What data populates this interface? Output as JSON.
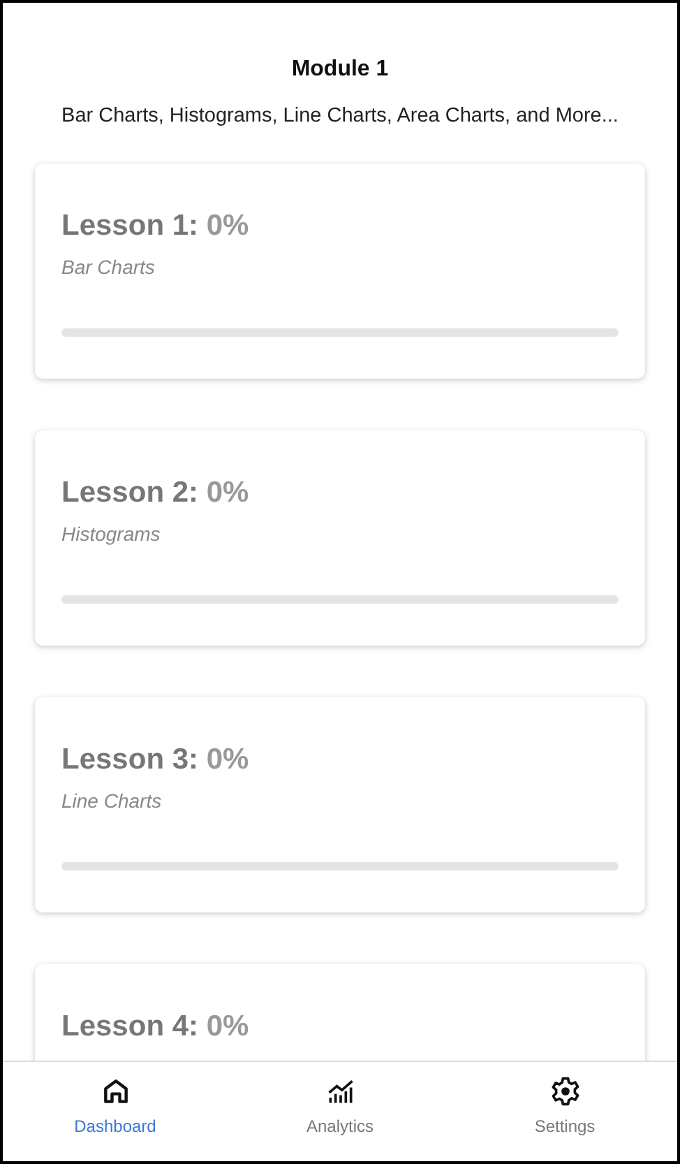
{
  "module": {
    "title": "Module 1",
    "subtitle": "Bar Charts, Histograms, Line Charts, Area Charts, and More..."
  },
  "lessons": [
    {
      "label": "Lesson 1:",
      "percent": "0%",
      "topic": "Bar Charts",
      "level": 0
    },
    {
      "label": "Lesson 2:",
      "percent": "0%",
      "topic": "Histograms",
      "level": 0
    },
    {
      "label": "Lesson 3:",
      "percent": "0%",
      "topic": "Line Charts",
      "level": 0
    },
    {
      "label": "Lesson 4:",
      "percent": "0%"
    }
  ],
  "tabs": [
    {
      "label": "Dashboard",
      "selected": true
    },
    {
      "label": "Analytics",
      "selected": false
    },
    {
      "label": "Settings",
      "selected": false
    }
  ]
}
